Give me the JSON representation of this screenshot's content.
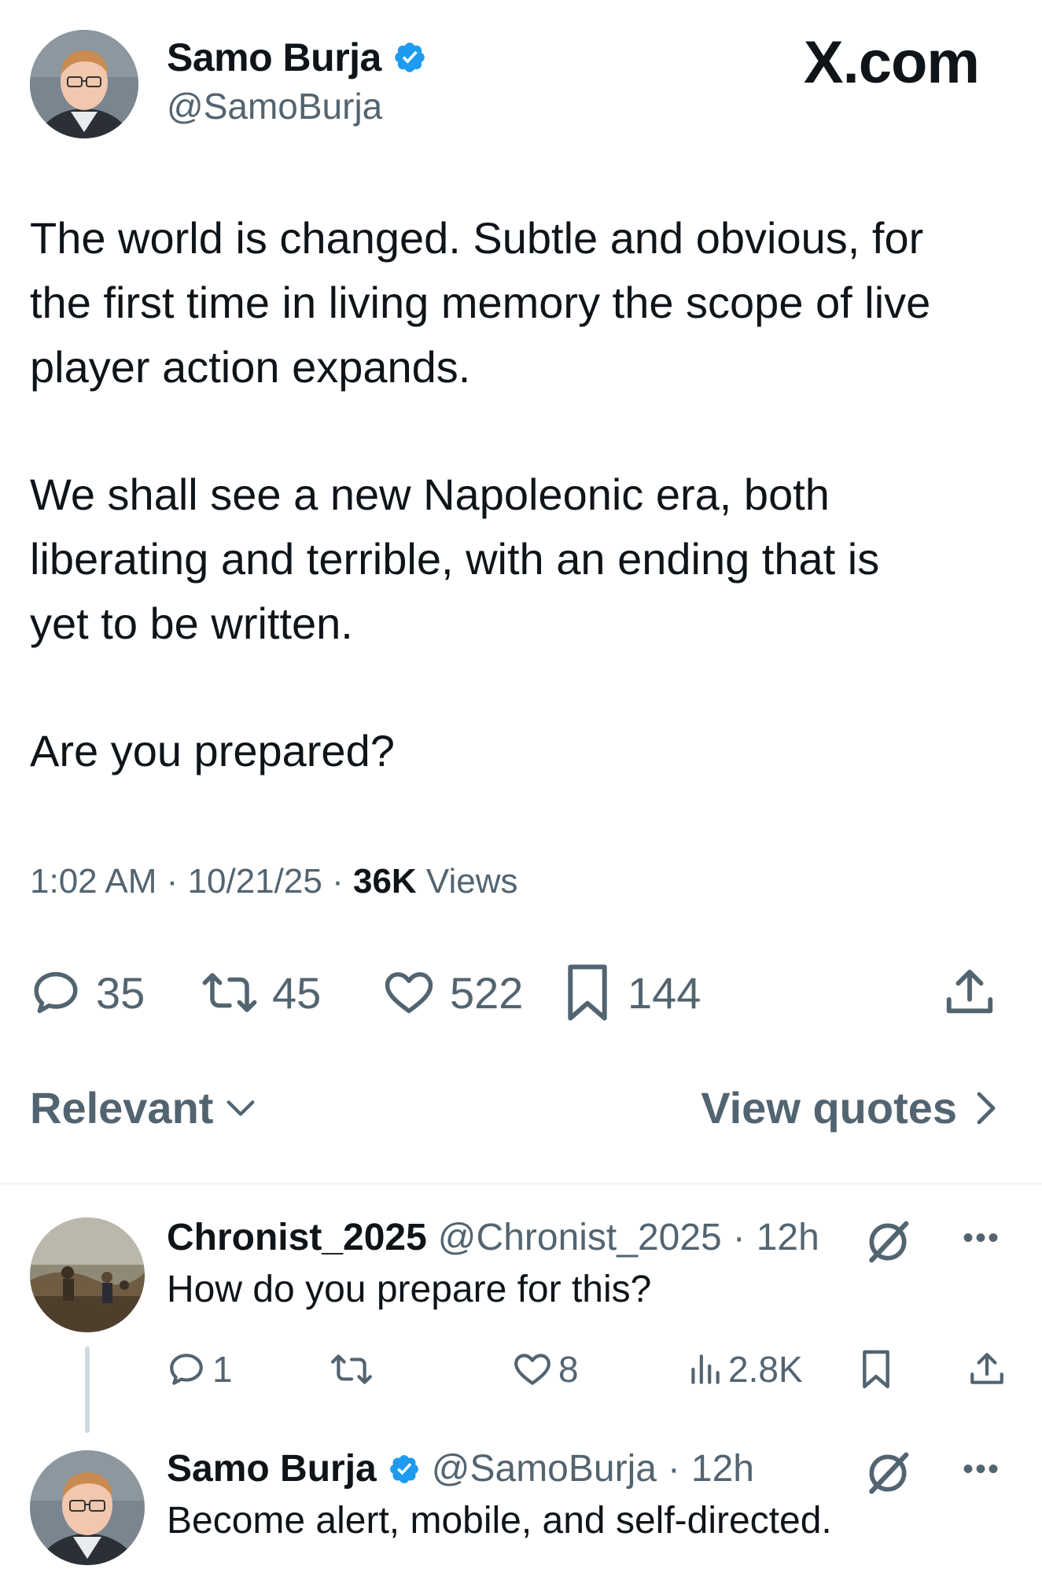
{
  "post": {
    "author": {
      "name": "Samo Burja",
      "handle": "@SamoBurja",
      "verified": true
    },
    "brand": "X.com",
    "paragraphs": [
      "The world is changed. Subtle and obvious, for\nthe first time in living memory the scope of live\nplayer action expands.",
      "We shall see a new Napoleonic era, both\nliberating and terrible, with an ending that is\nyet to be written.",
      "Are you prepared?"
    ],
    "time": "1:02 AM",
    "date": "10/21/25",
    "views_count": "36K",
    "views_label": "Views",
    "separator": "·",
    "stats": {
      "replies": "35",
      "reposts": "45",
      "likes": "522",
      "bookmarks": "144"
    }
  },
  "sort": {
    "label": "Relevant",
    "view_quotes": "View quotes"
  },
  "replies": [
    {
      "name": "Chronist_2025",
      "handle": "@Chronist_2025",
      "time": "12h",
      "text": "How do you prepare for this?",
      "stats": {
        "replies": "1",
        "likes": "8",
        "views": "2.8K"
      }
    },
    {
      "name": "Samo Burja",
      "handle": "@SamoBurja",
      "verified": true,
      "time": "12h",
      "text": "Become alert, mobile, and self-directed."
    }
  ],
  "colors": {
    "text": "#0f1419",
    "secondary": "#536471",
    "verified": "#1d9bf0",
    "divider": "#eff3f4"
  },
  "icons": [
    "verified-badge-icon",
    "reply-icon",
    "repost-icon",
    "like-icon",
    "bookmark-icon",
    "share-icon",
    "chevron-down-icon",
    "chevron-right-icon",
    "grok-icon",
    "more-icon",
    "views-icon"
  ]
}
